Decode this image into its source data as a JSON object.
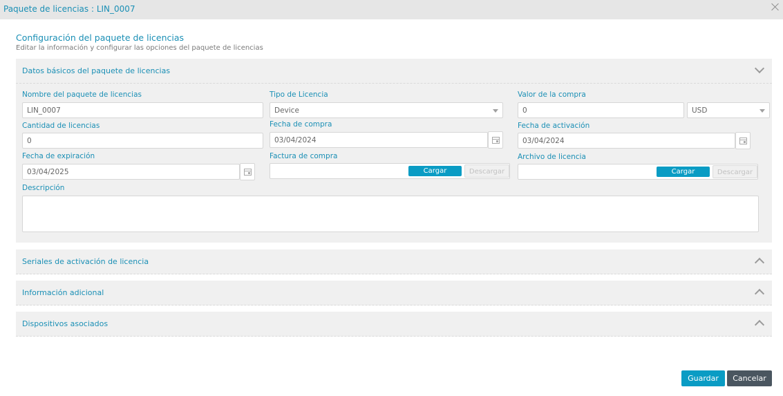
{
  "window": {
    "title": "Paquete de licencias : LIN_0007",
    "close_icon": "close-icon"
  },
  "page": {
    "title": "Configuración del paquete de licencias",
    "subtitle": "Editar la información y configurar las opciones del paquete de licencias"
  },
  "sections": {
    "basic": {
      "title": "Datos básicos del paquete de licencias",
      "state": "expanded",
      "fields": {
        "name": {
          "label": "Nombre del paquete de licencias",
          "value": "LIN_0007"
        },
        "license_type": {
          "label": "Tipo de Licencia",
          "value": "Device"
        },
        "purchase_value": {
          "label": "Valor de la compra",
          "value": "0",
          "currency": "USD"
        },
        "license_count": {
          "label": "Cantidad de licencias",
          "value": "0"
        },
        "purchase_date": {
          "label": "Fecha de compra",
          "value": "03/04/2024"
        },
        "activation_date": {
          "label": "Fecha de activación",
          "value": "03/04/2024"
        },
        "expiration_date": {
          "label": "Fecha de expiración",
          "value": "03/04/2025"
        },
        "purchase_invoice": {
          "label": "Factura de compra",
          "upload": "Cargar",
          "download": "Descargar"
        },
        "license_file": {
          "label": "Archivo de licencia",
          "upload": "Cargar",
          "download": "Descargar"
        },
        "description": {
          "label": "Descripción",
          "value": ""
        }
      }
    },
    "serials": {
      "title": "Seriales de activación de licencia",
      "state": "collapsed"
    },
    "additional": {
      "title": "Información adicional",
      "state": "collapsed"
    },
    "devices": {
      "title": "Dispositivos asociados",
      "state": "collapsed"
    }
  },
  "footer": {
    "save": "Guardar",
    "cancel": "Cancelar"
  },
  "colors": {
    "accent": "#1a8fb5",
    "primary_button": "#0a9cc4",
    "cancel_button": "#4a5660",
    "panel_bg": "#f0f0f0"
  }
}
